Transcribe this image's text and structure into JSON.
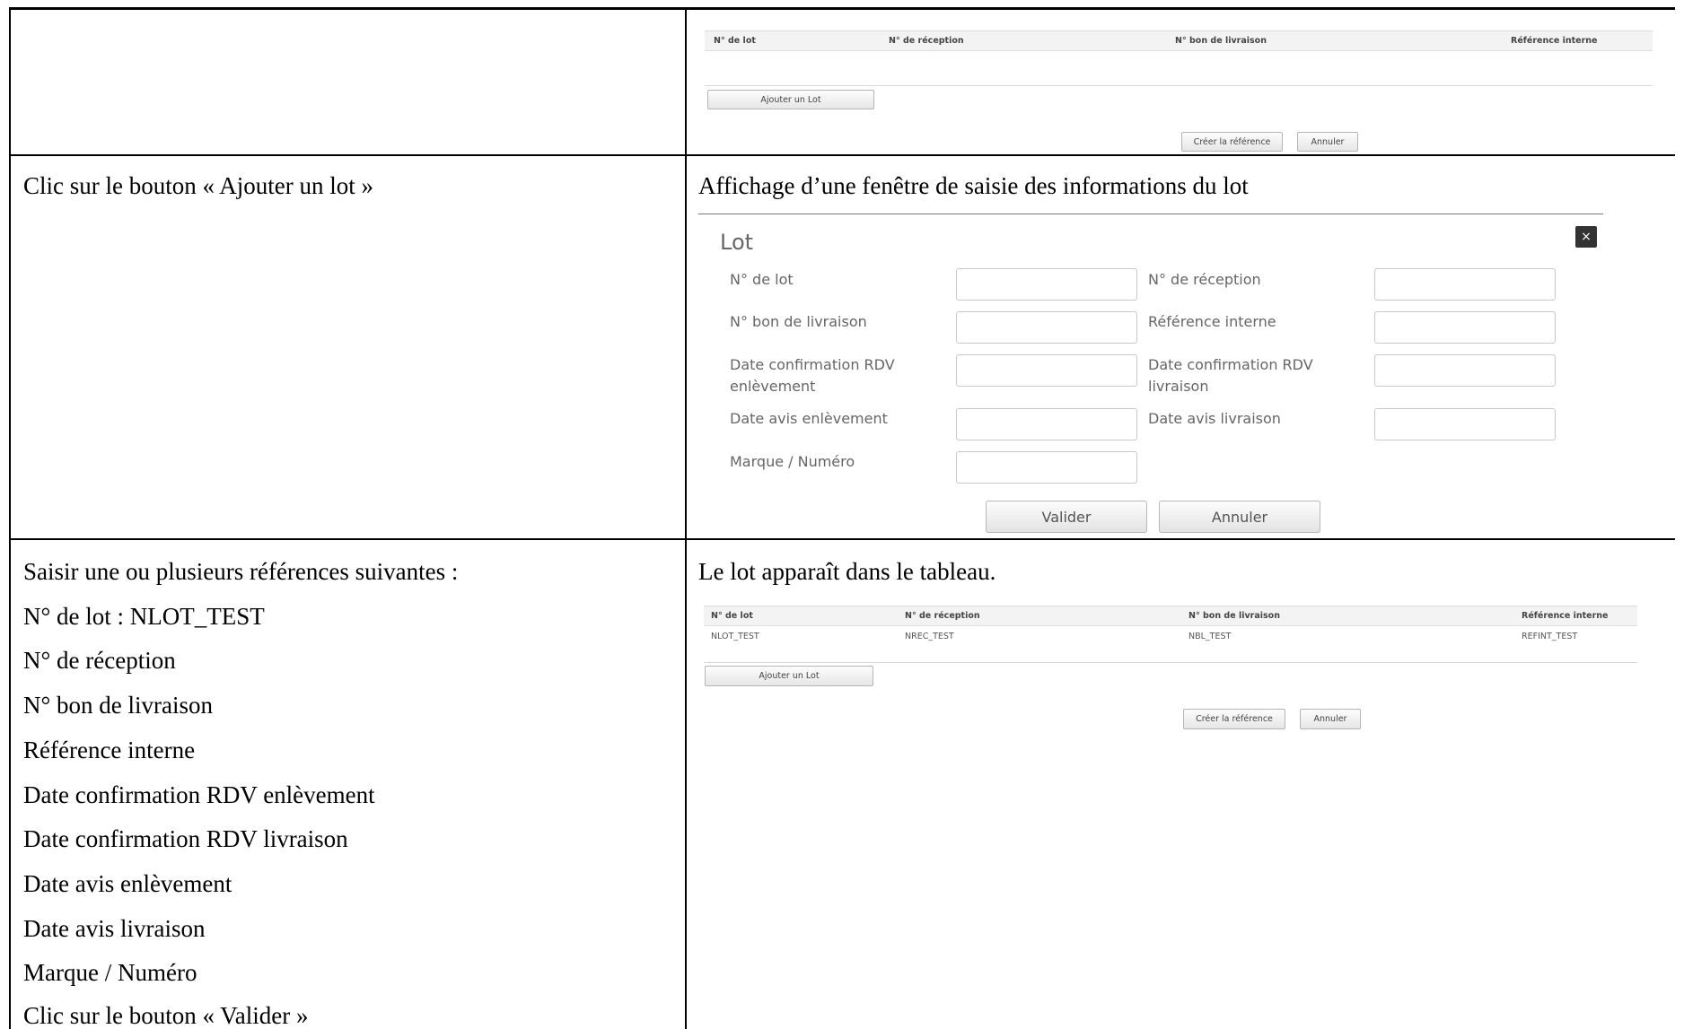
{
  "row1": {
    "table": {
      "headers": [
        "N° de lot",
        "N° de réception",
        "N° bon de livraison",
        "Référence interne"
      ]
    },
    "add_lot_button": "Ajouter un Lot",
    "create_reference_button": "Créer la référence",
    "cancel_button": "Annuler"
  },
  "row2": {
    "action": "Clic sur le bouton « Ajouter un lot »",
    "result": "Affichage d’une fenêtre de saisie des informations du lot",
    "modal": {
      "title": "Lot",
      "close": "×",
      "labels": {
        "lot_number": "N° de lot",
        "reception_number": "N° de réception",
        "delivery_note": "N° bon de livraison",
        "internal_reference": "Référence interne",
        "pickup_appointment_date": "Date confirmation RDV enlèvement",
        "delivery_appointment_date": "Date confirmation RDV livraison",
        "pickup_notice_date": "Date avis enlèvement",
        "delivery_notice_date": "Date avis livraison",
        "brand_number": "Marque / Numéro"
      },
      "validate_button": "Valider",
      "cancel_button": "Annuler"
    }
  },
  "row3": {
    "action_lines": [
      "Saisir une ou plusieurs références suivantes :",
      "N° de lot : NLOT_TEST",
      "N° de réception",
      "N° bon de livraison",
      "Référence interne",
      "Date confirmation RDV enlèvement",
      "Date confirmation RDV livraison",
      "Date avis enlèvement",
      "Date avis livraison",
      "Marque / Numéro",
      "Clic sur le bouton « Valider »"
    ],
    "result": "Le lot apparaît dans le tableau.",
    "table": {
      "headers": [
        "N° de lot",
        "N° de réception",
        "N° bon de livraison",
        "Référence interne"
      ],
      "rows": [
        [
          "NLOT_TEST",
          "NREC_TEST",
          "NBL_TEST",
          "REFINT_TEST"
        ]
      ]
    },
    "add_lot_button": "Ajouter un Lot",
    "create_reference_button": "Créer la référence",
    "cancel_button": "Annuler"
  }
}
